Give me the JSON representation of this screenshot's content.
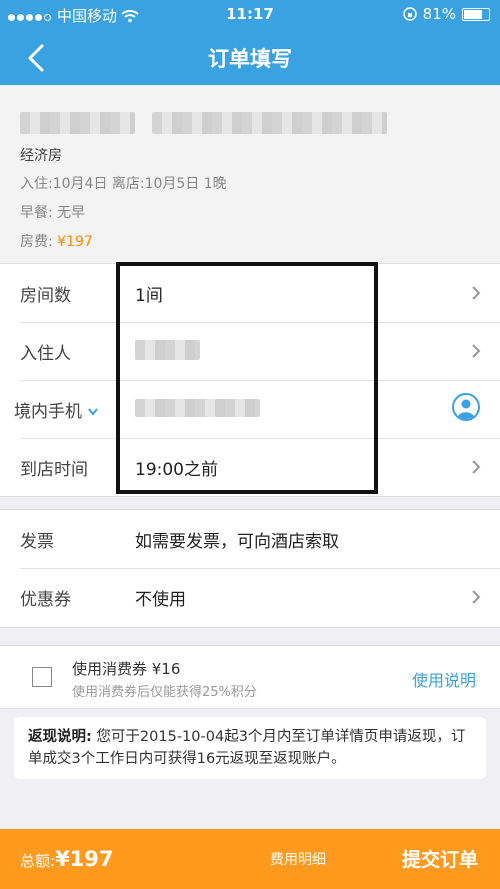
{
  "status_bar": {
    "carrier": "中国移动",
    "time": "11:17",
    "battery": "81%",
    "battery_level": 0.81
  },
  "nav": {
    "title": "订单填写"
  },
  "hotel": {
    "room_type": "经济房",
    "stay": "入住:10月4日  离店:10月5日  1晚",
    "breakfast": "早餐: 无早",
    "room_fee_label": "房费:",
    "room_fee": "¥197"
  },
  "form": [
    {
      "label": "房间数",
      "value": "1间"
    },
    {
      "label": "入住人",
      "value": ""
    },
    {
      "label": "境内手机",
      "value": ""
    },
    {
      "label": "到店时间",
      "value": "19:00之前"
    }
  ],
  "invoice": {
    "label": "发票",
    "value": "如需要发票，可向酒店索取"
  },
  "voucher": {
    "label": "优惠券",
    "value": "不使用"
  },
  "consumption_coupon": {
    "title": "使用消费券 ¥16",
    "subtitle": "使用消费券后仅能获得25%积分",
    "link": "使用说明",
    "checked": false
  },
  "cashback": {
    "label": "返现说明:",
    "text": " 您可于2015-10-04起3个月内至订单详情页申请返现，订单成交3个工作日内可获得16元返现至返现账户。"
  },
  "footer": {
    "total_label": "总额:",
    "total_amount": "¥197",
    "detail": "费用明细",
    "submit": "提交订单"
  },
  "colors": {
    "primary": "#3aa2e0",
    "accent": "#ff9a1f",
    "price": "#ff8a00"
  }
}
